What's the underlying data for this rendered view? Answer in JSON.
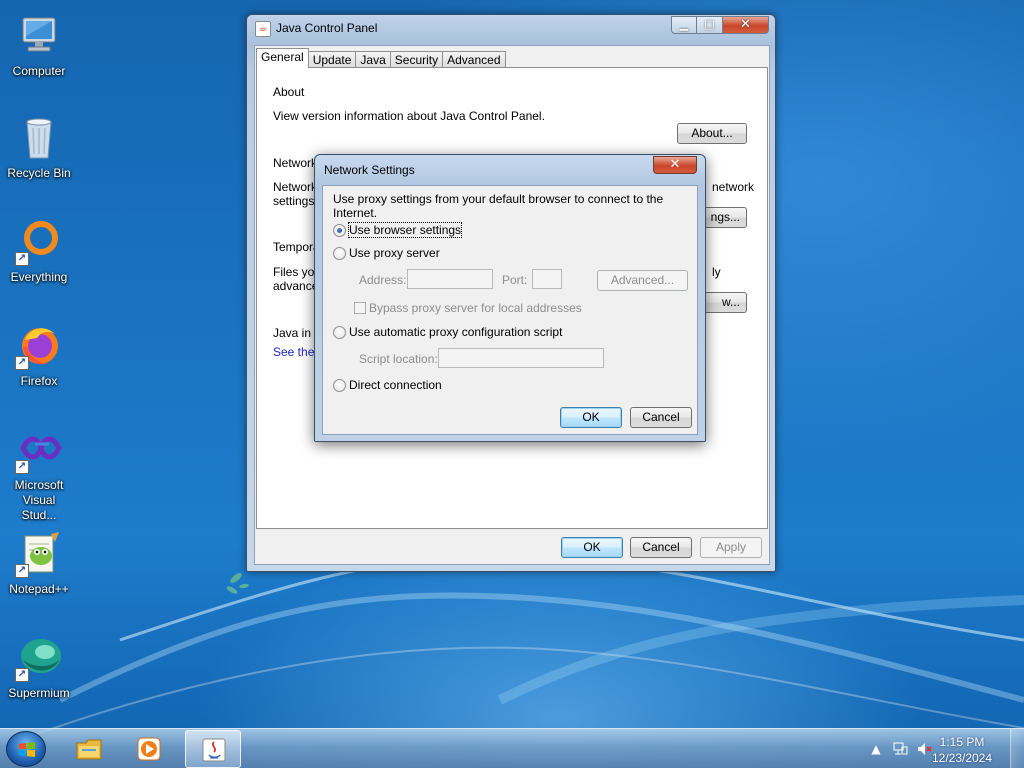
{
  "desktop": {
    "icons": [
      {
        "label": "Computer",
        "icon": "computer-icon"
      },
      {
        "label": "Recycle Bin",
        "icon": "recycle-bin-icon"
      },
      {
        "label": "Everything",
        "icon": "everything-icon"
      },
      {
        "label": "Firefox",
        "icon": "firefox-icon"
      },
      {
        "label": "Microsoft Visual Stud...",
        "icon": "visual-studio-icon"
      },
      {
        "label": "Notepad++",
        "icon": "notepad-plus-plus-icon"
      },
      {
        "label": "Supermium",
        "icon": "supermium-icon"
      }
    ]
  },
  "jcp": {
    "title": "Java Control Panel",
    "tabs": [
      "General",
      "Update",
      "Java",
      "Security",
      "Advanced"
    ],
    "active_tab": "General",
    "about": {
      "heading": "About",
      "text": "View version information about Java Control Panel.",
      "button": "About..."
    },
    "network": {
      "heading": "Network",
      "text_left_1": "Network",
      "text_left_2": "settings i",
      "text_right": "network",
      "button": "ngs..."
    },
    "temp": {
      "heading": "Temporar",
      "text_left_1": "Files you",
      "text_left_2": "advanced",
      "text_right": "ly",
      "button": "w..."
    },
    "java_browser": {
      "heading": "Java in th",
      "link": "See the S"
    },
    "buttons": {
      "ok": "OK",
      "cancel": "Cancel",
      "apply": "Apply"
    }
  },
  "network_dialog": {
    "title": "Network Settings",
    "intro": "Use proxy settings from your default browser to connect to the Internet.",
    "options": {
      "browser": "Use browser settings",
      "proxy": "Use proxy server",
      "auto_script": "Use automatic proxy configuration script",
      "direct": "Direct connection"
    },
    "selected_option": "browser",
    "address_label": "Address:",
    "address_value": "",
    "port_label": "Port:",
    "port_value": "",
    "advanced_button": "Advanced...",
    "bypass_label": "Bypass proxy server for local addresses",
    "bypass_checked": false,
    "script_label": "Script location:",
    "script_value": "",
    "ok": "OK",
    "cancel": "Cancel"
  },
  "taskbar": {
    "pinned": [
      "windows-explorer-icon",
      "media-player-icon",
      "java-icon"
    ],
    "active": "java-icon",
    "clock_time": "1:15 PM",
    "clock_date": "12/23/2024"
  },
  "colors": {
    "accent": "#3c7fb1",
    "link": "#1a27c9",
    "wallpaper": "#1a74c2"
  }
}
